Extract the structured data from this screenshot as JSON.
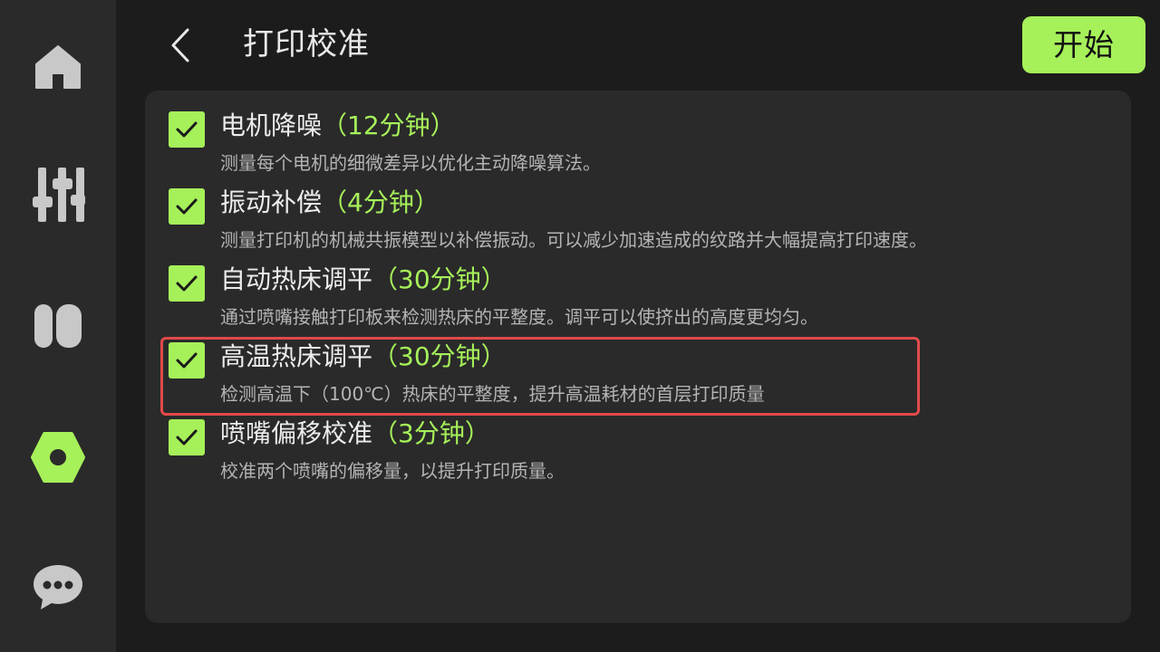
{
  "sidebar": {
    "items": [
      {
        "icon": "home-icon",
        "active": false
      },
      {
        "icon": "sliders-icon",
        "active": false
      },
      {
        "icon": "filament-icon",
        "active": false
      },
      {
        "icon": "settings-nut-icon",
        "active": true
      },
      {
        "icon": "chat-icon",
        "active": false
      }
    ]
  },
  "header": {
    "back_icon": "back-chevron-icon",
    "title": "打印校准",
    "start_label": "开始"
  },
  "colors": {
    "accent": "#a6f05a",
    "highlight_border": "#e04a4a"
  },
  "calibration": {
    "items": [
      {
        "title": "电机降噪",
        "duration": "（12分钟）",
        "desc": "测量每个电机的细微差异以优化主动降噪算法。",
        "checked": true
      },
      {
        "title": "振动补偿",
        "duration": "（4分钟）",
        "desc": "测量打印机的机械共振模型以补偿振动。可以减少加速造成的纹路并大幅提高打印速度。",
        "checked": true
      },
      {
        "title": "自动热床调平",
        "duration": "（30分钟）",
        "desc": "通过喷嘴接触打印板来检测热床的平整度。调平可以使挤出的高度更均匀。",
        "checked": true
      },
      {
        "title": "高温热床调平",
        "duration": "（30分钟）",
        "desc": "检测高温下（100℃）热床的平整度，提升高温耗材的首层打印质量",
        "checked": true,
        "highlighted": true
      },
      {
        "title": "喷嘴偏移校准",
        "duration": "（3分钟）",
        "desc": "校准两个喷嘴的偏移量，以提升打印质量。",
        "checked": true
      }
    ]
  }
}
